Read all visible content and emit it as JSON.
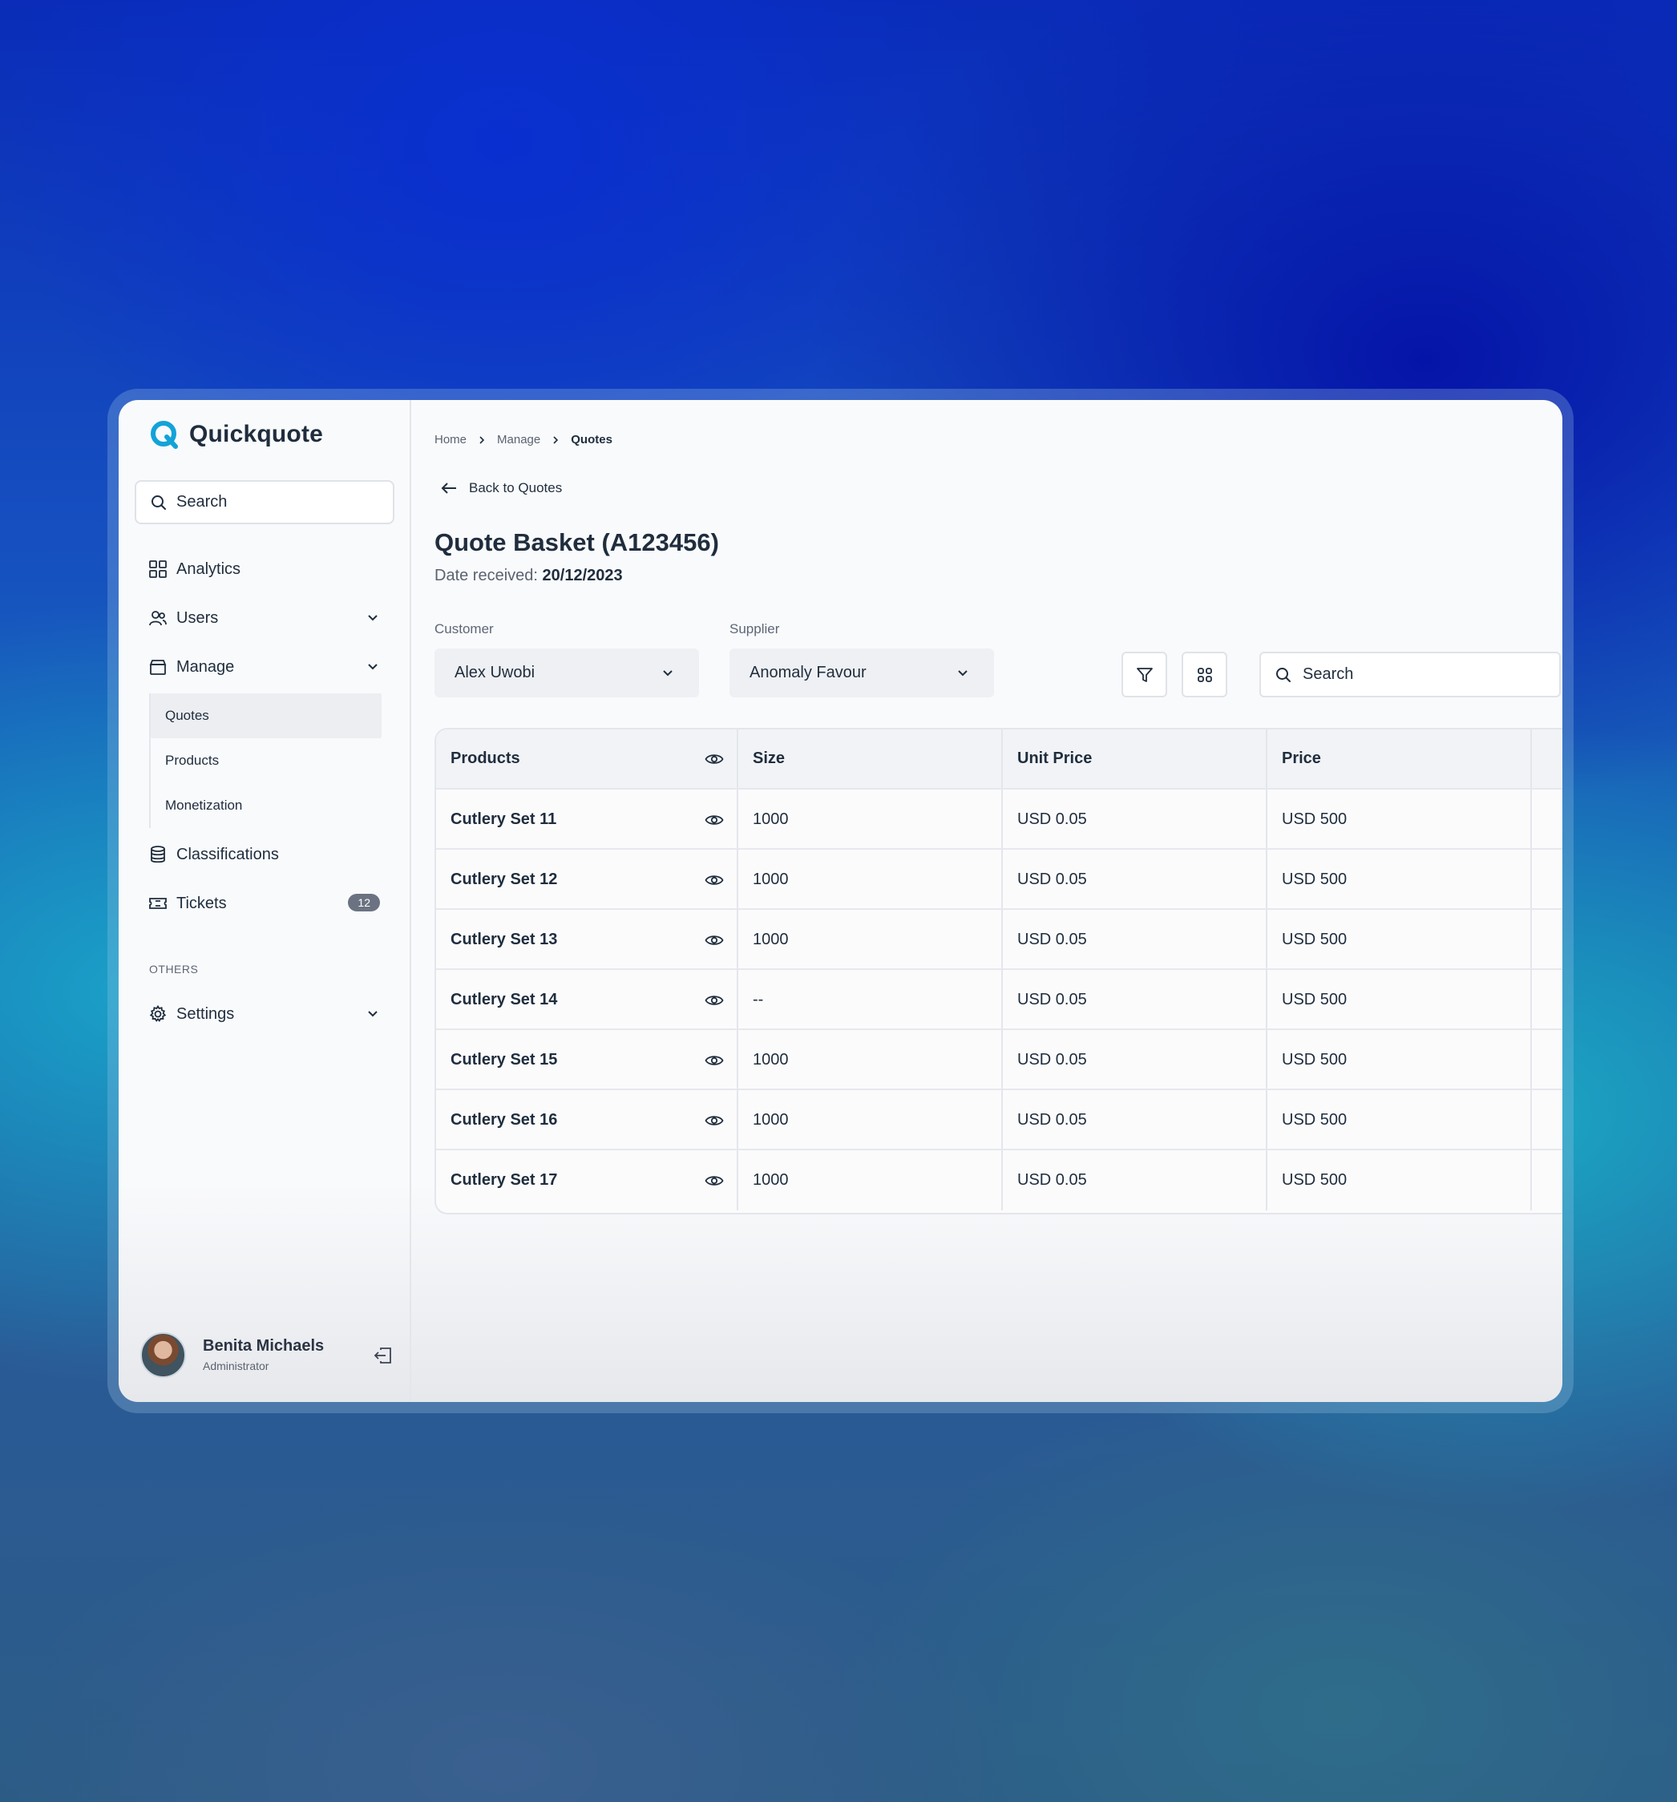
{
  "brand": {
    "name": "Quickquote"
  },
  "sidebar": {
    "search_label": "Search",
    "items": [
      {
        "label": "Analytics",
        "icon": "grid-icon"
      },
      {
        "label": "Users",
        "icon": "users-icon"
      },
      {
        "label": "Manage",
        "icon": "box-icon"
      },
      {
        "label": "Classifications",
        "icon": "database-icon"
      },
      {
        "label": "Tickets",
        "icon": "ticket-icon",
        "badge": "12"
      }
    ],
    "manage_sub": [
      "Quotes",
      "Products",
      "Monetization"
    ],
    "active_sub": "Quotes",
    "section_label": "OTHERS",
    "settings_label": "Settings"
  },
  "user": {
    "name": "Benita Michaels",
    "role": "Administrator"
  },
  "breadcrumb": [
    "Home",
    "Manage",
    "Quotes"
  ],
  "back_label": "Back to Quotes",
  "page": {
    "title": "Quote Basket (A123456)",
    "date_label": "Date received:",
    "date_value": "20/12/2023"
  },
  "filters": {
    "customer_label": "Customer",
    "customer_value": "Alex Uwobi",
    "supplier_label": "Supplier",
    "supplier_value": "Anomaly Favour",
    "search_placeholder": "Search"
  },
  "table": {
    "headers": [
      "Products",
      "Size",
      "Unit Price",
      "Price"
    ],
    "rows": [
      {
        "product": "Cutlery Set 11",
        "size": "1000",
        "unit_price": "USD 0.05",
        "price": "USD 500"
      },
      {
        "product": "Cutlery Set 12",
        "size": "1000",
        "unit_price": "USD 0.05",
        "price": "USD 500"
      },
      {
        "product": "Cutlery Set 13",
        "size": "1000",
        "unit_price": "USD 0.05",
        "price": "USD 500"
      },
      {
        "product": "Cutlery Set 14",
        "size": "--",
        "unit_price": "USD 0.05",
        "price": "USD 500"
      },
      {
        "product": "Cutlery Set 15",
        "size": "1000",
        "unit_price": "USD 0.05",
        "price": "USD 500"
      },
      {
        "product": "Cutlery Set 16",
        "size": "1000",
        "unit_price": "USD 0.05",
        "price": "USD 500"
      },
      {
        "product": "Cutlery Set 17",
        "size": "1000",
        "unit_price": "USD 0.05",
        "price": "USD 500"
      }
    ]
  },
  "colors": {
    "brand": "#12a3d8",
    "text": "#1f2d3d",
    "badge": "#6b7382"
  }
}
